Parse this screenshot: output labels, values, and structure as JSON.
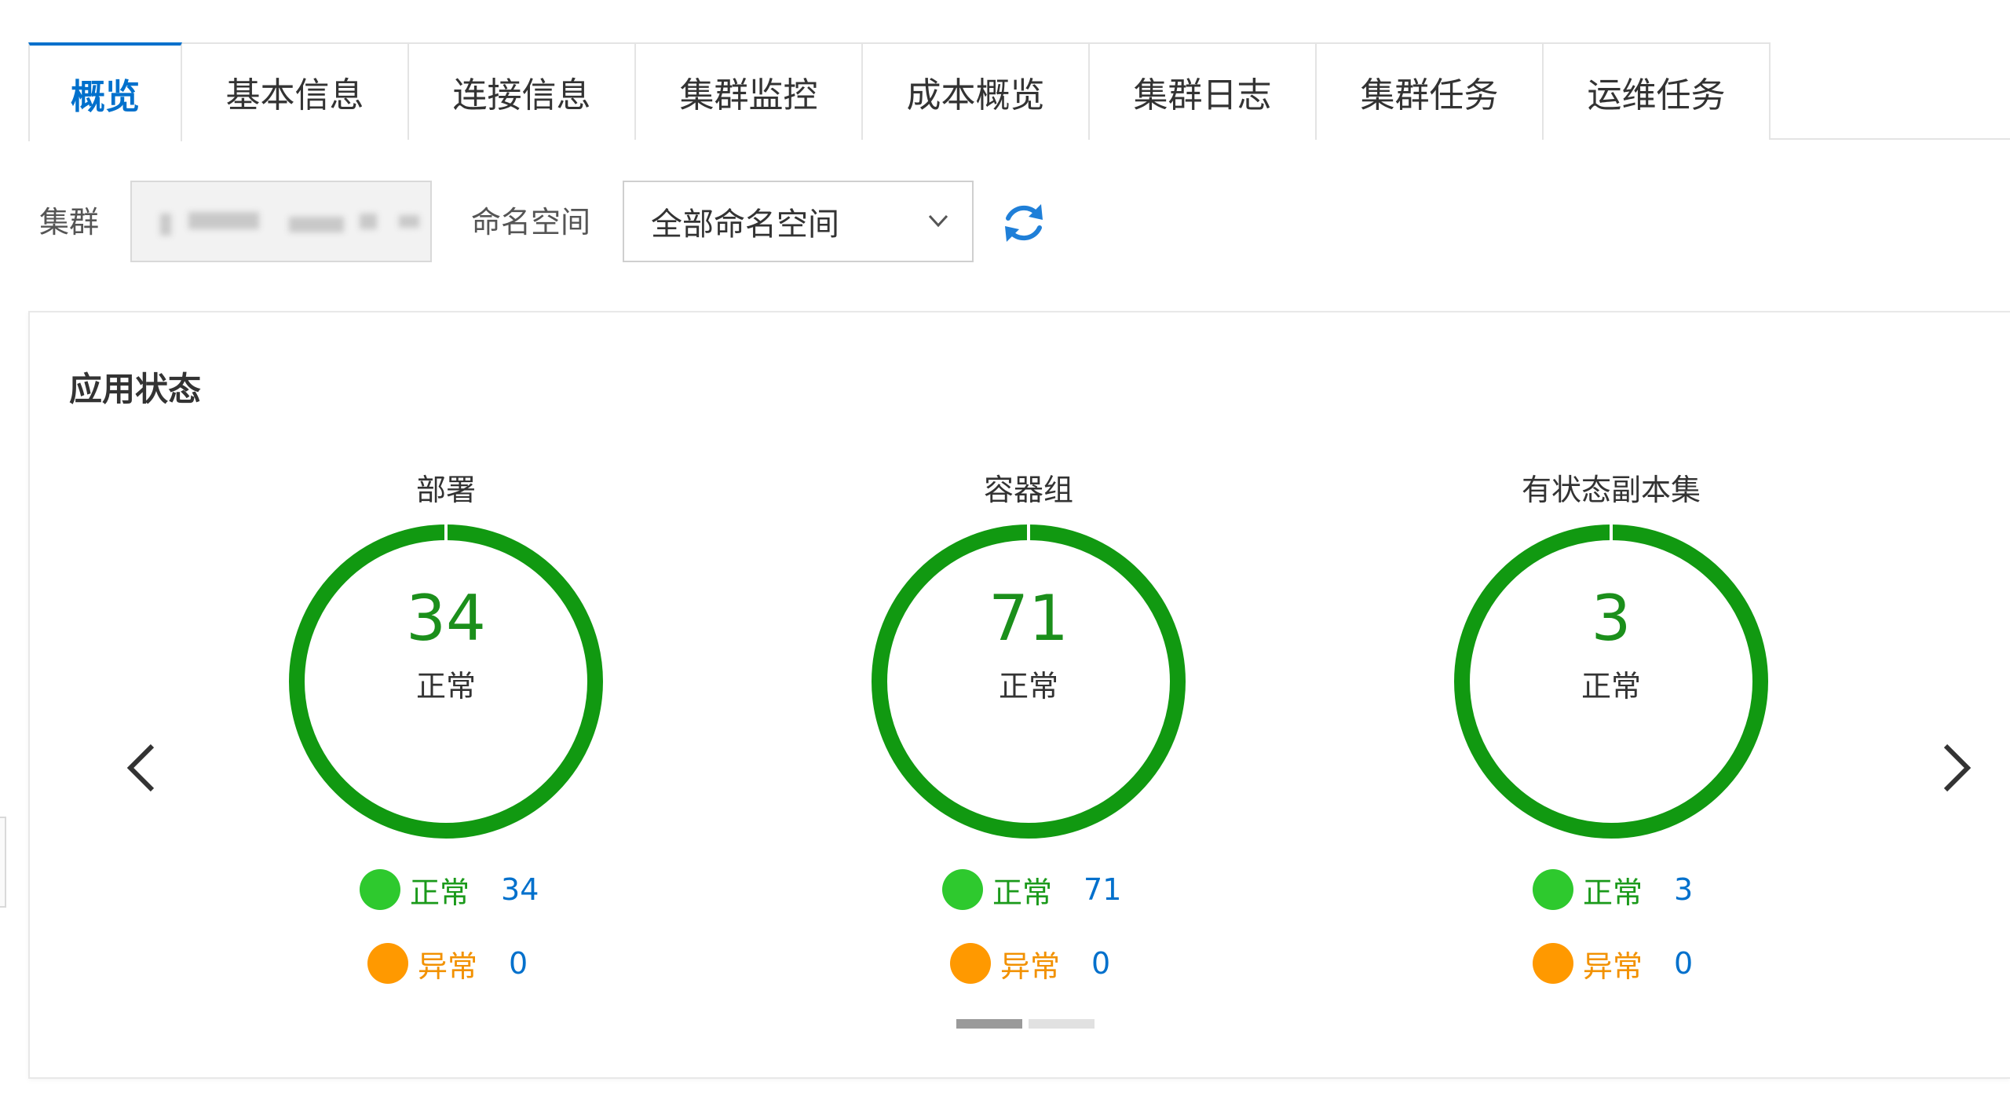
{
  "tabs": [
    {
      "label": "概览",
      "active": true
    },
    {
      "label": "基本信息",
      "active": false
    },
    {
      "label": "连接信息",
      "active": false
    },
    {
      "label": "集群监控",
      "active": false
    },
    {
      "label": "成本概览",
      "active": false
    },
    {
      "label": "集群日志",
      "active": false
    },
    {
      "label": "集群任务",
      "active": false
    },
    {
      "label": "运维任务",
      "active": false
    }
  ],
  "filters": {
    "cluster_label": "集群",
    "namespace_label": "命名空间",
    "namespace_value": "全部命名空间"
  },
  "card": {
    "title": "应用状态",
    "panels": [
      {
        "name": "部署",
        "total": "34",
        "state": "正常",
        "normal_label": "正常",
        "normal_count": "34",
        "abnormal_label": "异常",
        "abnormal_count": "0"
      },
      {
        "name": "容器组",
        "total": "71",
        "state": "正常",
        "normal_label": "正常",
        "normal_count": "71",
        "abnormal_label": "异常",
        "abnormal_count": "0"
      },
      {
        "name": "有状态副本集",
        "total": "3",
        "state": "正常",
        "normal_label": "正常",
        "normal_count": "3",
        "abnormal_label": "异常",
        "abnormal_count": "0"
      }
    ]
  },
  "colors": {
    "accent": "#0070cc",
    "normal": "#2ec92e",
    "ring": "#119911",
    "abnormal": "#ff9900"
  }
}
